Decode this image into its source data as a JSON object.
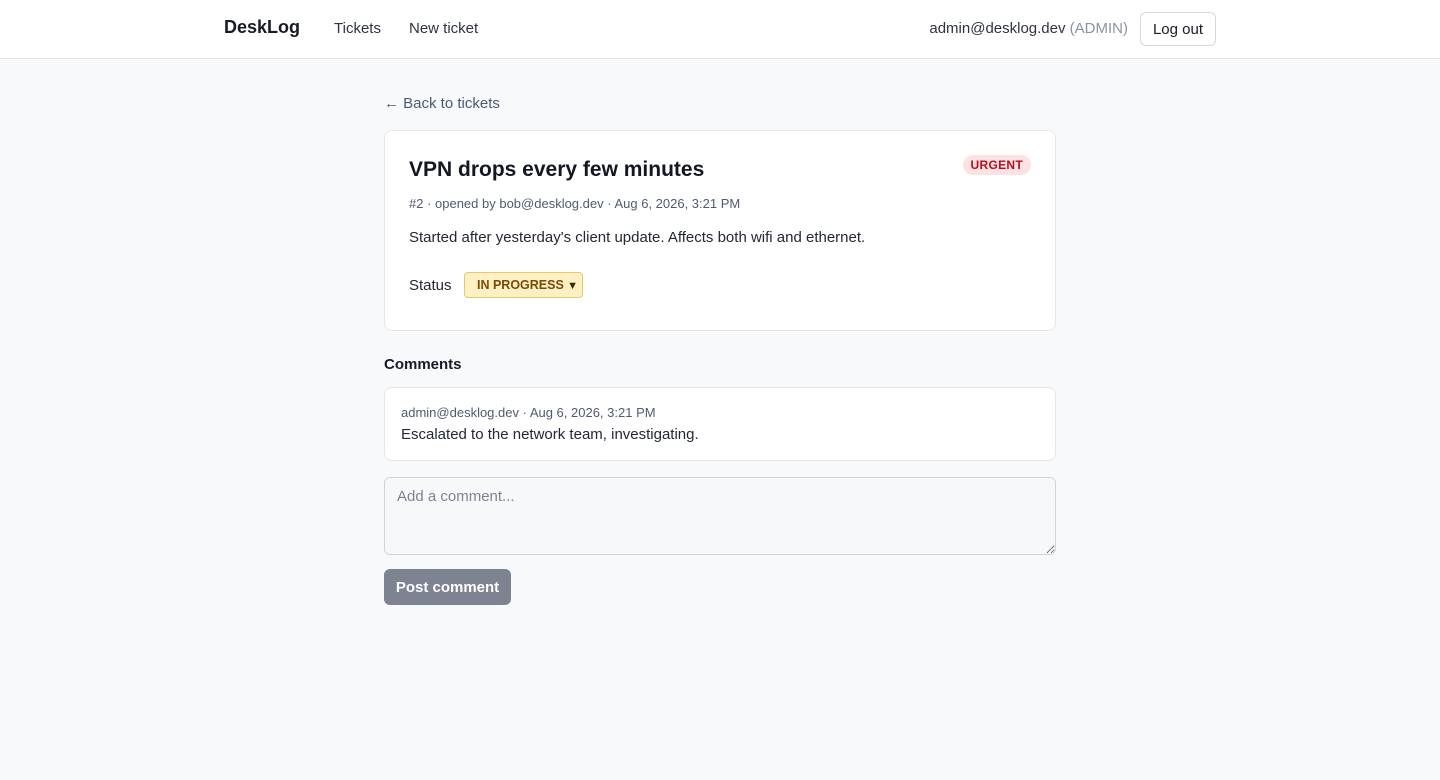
{
  "header": {
    "brand": "DeskLog",
    "nav": {
      "tickets": "Tickets",
      "new_ticket": "New ticket"
    },
    "user_email": "admin@desklog.dev",
    "user_role": "(ADMIN)",
    "logout_label": "Log out"
  },
  "back_link": "← Back to tickets",
  "ticket": {
    "title": "VPN drops every few minutes",
    "priority": "URGENT",
    "meta": "#2 · opened by bob@desklog.dev · Aug 6, 2026, 3:21 PM",
    "description": "Started after yesterday's client update. Affects both wifi and ethernet.",
    "status_label": "Status",
    "status_value": "IN PROGRESS"
  },
  "comments": {
    "heading": "Comments",
    "items": [
      {
        "meta": "admin@desklog.dev · Aug 6, 2026, 3:21 PM",
        "body": "Escalated to the network team, investigating."
      }
    ],
    "input_placeholder": "Add a comment...",
    "post_label": "Post comment"
  },
  "colors": {
    "urgent_badge_bg": "#fde2e4",
    "urgent_badge_text": "#b3101f",
    "status_bg": "#fdf1c4",
    "status_text": "#7a4a06",
    "post_button_bg": "#7d8391"
  },
  "icons": {
    "back": "left-arrow-icon",
    "status_dropdown": "chevron-down-icon"
  }
}
